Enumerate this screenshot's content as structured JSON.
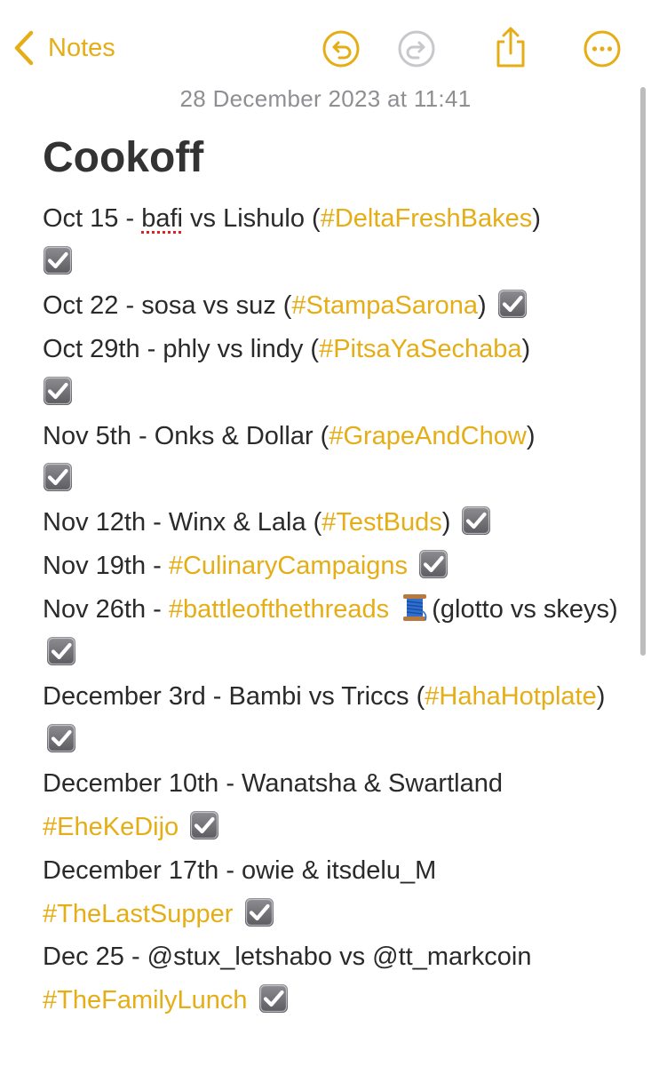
{
  "toolbar": {
    "back_label": "Notes",
    "icons": [
      "undo-icon",
      "redo-icon",
      "share-icon",
      "more-icon"
    ]
  },
  "note": {
    "timestamp": "28 December 2023 at 11:41",
    "title": "Cookoff",
    "entries": [
      {
        "pre": "Oct 15 - ",
        "misspelled": "bafi",
        "mid": " vs Lishulo (",
        "tag": "#DeltaFreshBakes",
        "post": ")"
      },
      {
        "pre": "Oct 22 - sosa vs suz (",
        "tag": "#StampaSarona",
        "post": ")"
      },
      {
        "pre": "Oct 29th - phly vs lindy (",
        "tag": "#PitsaYaSechaba",
        "post": ")"
      },
      {
        "pre": "Nov 5th - Onks & Dollar (",
        "tag": "#GrapeAndChow",
        "post": ")"
      },
      {
        "pre": "Nov 12th - Winx & Lala (",
        "tag": "#TestBuds",
        "post": ")"
      },
      {
        "pre": "Nov 19th - ",
        "tag": "#CulinaryCampaigns",
        "post": ""
      },
      {
        "pre": "Nov 26th - ",
        "tag": "#battleofthethreads",
        "post": "(glotto vs skeys)"
      },
      {
        "pre": "December 3rd - Bambi vs Triccs (",
        "tag": "#HahaHotplate",
        "post": ")"
      },
      {
        "pre": "December 10th - Wanatsha & Swartland ",
        "tag": "#EheKeDijo",
        "post": ""
      },
      {
        "pre": "December 17th - owie & itsdelu_M ",
        "tag": "#TheLastSupper",
        "post": ""
      },
      {
        "pre": "Dec 25 - @stux_letshabo vs @tt_markcoin ",
        "tag": "#TheFamilyLunch",
        "post": ""
      }
    ]
  },
  "colors": {
    "accent": "#E5AE16",
    "timestamp": "#8e8e93",
    "checkbox": "#6d6d72",
    "spellcheck": "#e02020"
  }
}
